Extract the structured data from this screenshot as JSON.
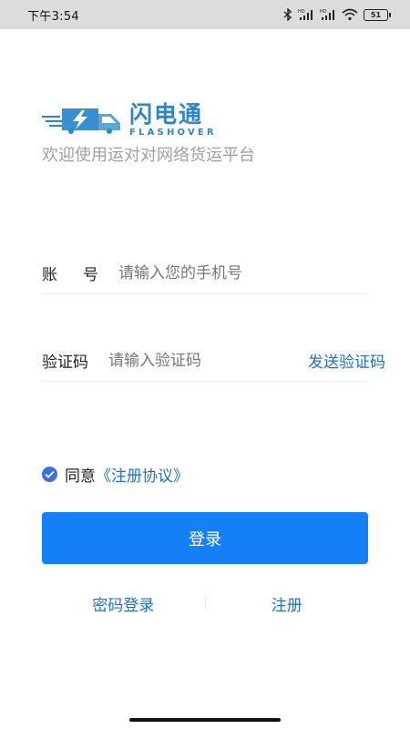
{
  "status_bar": {
    "time": "下午3:54",
    "battery": "51",
    "icons": [
      "bluetooth-icon",
      "signal-hd-icon",
      "signal-hd-icon",
      "wifi-icon",
      "battery-icon"
    ]
  },
  "brand": {
    "name_cn": "闪电通",
    "name_en": "FLASHOVER",
    "logo_icon": "delivery-truck-lightning-icon",
    "tagline": "欢迎使用运对对网络货运平台",
    "color": "#2d86c6"
  },
  "form": {
    "account": {
      "label_chars": [
        "账",
        "号"
      ],
      "placeholder": "请输入您的手机号"
    },
    "code": {
      "label_chars": [
        "验",
        "证",
        "码"
      ],
      "placeholder": "请输入验证码",
      "send_label": "发送验证码"
    }
  },
  "agreement": {
    "checked": true,
    "prefix": "同意",
    "link": "《注册协议》"
  },
  "login_button": {
    "label": "登录",
    "color": "#1580f5"
  },
  "bottom_links": {
    "password_login": "密码登录",
    "register": "注册"
  }
}
